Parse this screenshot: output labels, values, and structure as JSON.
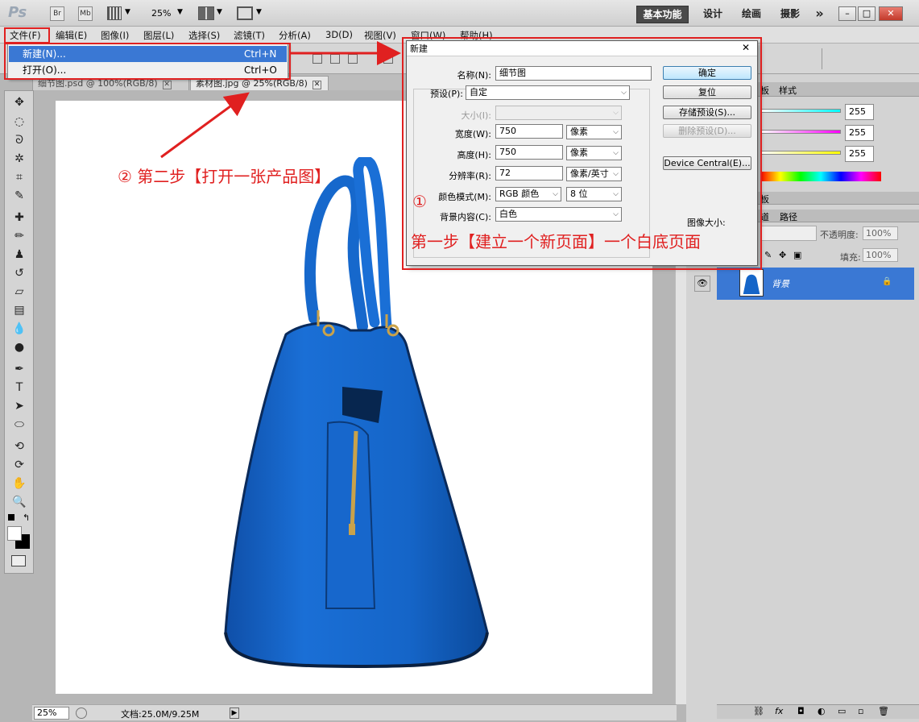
{
  "titlebar": {
    "app_logo": "Ps",
    "br_label": "Br",
    "mb_label": "Mb",
    "zoom": "25%",
    "workspaces": [
      "基本功能",
      "设计",
      "绘画",
      "摄影"
    ],
    "more": "»",
    "win_min": "–",
    "win_max": "□",
    "win_close": "✕"
  },
  "menubar": {
    "items": [
      "文件(F)",
      "编辑(E)",
      "图像(I)",
      "图层(L)",
      "选择(S)",
      "滤镜(T)",
      "分析(A)",
      "3D(D)",
      "视图(V)",
      "窗口(W)",
      "帮助(H)"
    ]
  },
  "file_menu": {
    "items": [
      {
        "label": "新建(N)...",
        "shortcut": "Ctrl+N"
      },
      {
        "label": "打开(O)...",
        "shortcut": "Ctrl+O"
      }
    ]
  },
  "tabs": [
    {
      "label": "细节图.psd @ 100%(RGB/8)",
      "close": "✕"
    },
    {
      "label": "素材图.jpg @ 25%(RGB/8)",
      "close": "✕"
    }
  ],
  "dialog": {
    "title": "新建",
    "close": "✕",
    "name_label": "名称(N):",
    "name_value": "细节图",
    "preset_label": "预设(P):",
    "preset_value": "自定",
    "size_label": "大小(I):",
    "width_label": "宽度(W):",
    "width_value": "750",
    "width_unit": "像素",
    "height_label": "高度(H):",
    "height_value": "750",
    "height_unit": "像素",
    "resolution_label": "分辨率(R):",
    "resolution_value": "72",
    "resolution_unit": "像素/英寸",
    "colormode_label": "颜色模式(M):",
    "colormode_value": "RGB 颜色",
    "bitdepth_value": "8 位",
    "background_label": "背景内容(C):",
    "background_value": "白色",
    "image_size_label": "图像大小:",
    "buttons": {
      "ok": "确定",
      "reset": "复位",
      "save_preset": "存储预设(S)...",
      "delete_preset": "删除预设(D)...",
      "device_central": "Device Central(E)..."
    }
  },
  "annotations": {
    "step1_circle": "①",
    "step1": "第一步【建立一个新页面】一个白底页面",
    "step2": "② 第二步【打开一张产品图】"
  },
  "right_panel": {
    "tab_swatches_partial": "板",
    "tab_styles": "样式",
    "r_value": "255",
    "g_value": "255",
    "b_value": "255",
    "adjust_partial": "板",
    "paths_tab_partial": "道",
    "paths_tab": "路径",
    "opacity_label": "不透明度:",
    "opacity_value": "100%",
    "fill_label": "填充:",
    "fill_value": "100%",
    "layer_name": "背景",
    "lock_icon_char": "🔒"
  },
  "status": {
    "zoom": "25%",
    "doc_info": "文档:25.0M/9.25M"
  },
  "colors": {
    "bag_blue": "#1565c8",
    "accent_red": "#e02020",
    "selection_blue": "#3a78d4"
  }
}
